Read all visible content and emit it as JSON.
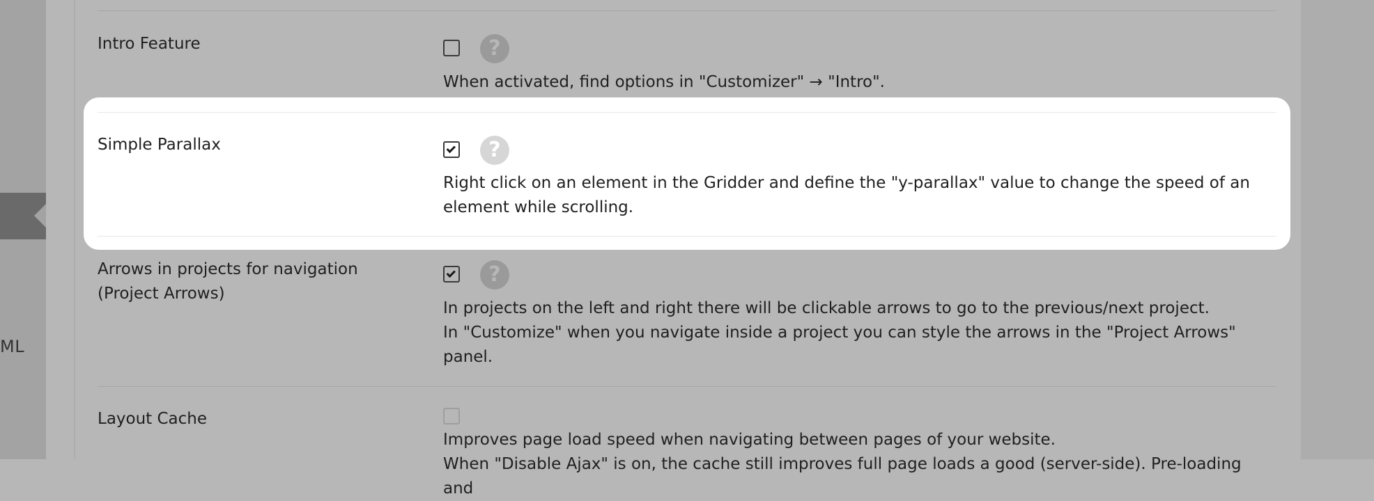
{
  "sidebar": {
    "fragment_text": "ML"
  },
  "rows": [
    {
      "label": "Intro Feature",
      "checked": false,
      "help_glyph": "?",
      "description": "When activated, find options in \"Customizer\" → \"Intro\"."
    },
    {
      "label": "Simple Parallax",
      "checked": true,
      "help_glyph": "?",
      "description": "Right click on an element in the Gridder and define the \"y-parallax\" value to change the speed of an element while scrolling."
    },
    {
      "label": "Arrows in projects for navigation (Project Arrows)",
      "checked": true,
      "help_glyph": "?",
      "description_line1": "In projects on the left and right there will be clickable arrows to go to the previous/next project.",
      "description_line2": "In \"Customize\" when you navigate inside a project you can style the arrows in the \"Project Arrows\" panel."
    },
    {
      "label": "Layout Cache",
      "checked": false,
      "disabled": true,
      "description_line1": "Improves page load speed when navigating between pages of your website.",
      "description_line2": "When \"Disable Ajax\" is on, the cache still improves full page loads a good (server-side). Pre-loading and"
    }
  ],
  "colors": {
    "overlay": "#b7b7b7",
    "highlight_bg": "#ffffff",
    "help_icon": "#9a9a9a"
  }
}
